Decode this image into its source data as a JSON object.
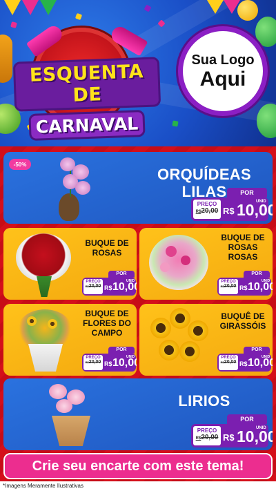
{
  "header": {
    "title_line1": "ESQUENTA DE",
    "title_line2": "CARNAVAL",
    "logo_line1": "Sua Logo",
    "logo_line2": "Aqui"
  },
  "products": [
    {
      "name": "ORQUÍDEAS LILAS",
      "discount": "-50%",
      "por": "POR",
      "preco_label": "PREÇO",
      "old_prefix": "R$",
      "old_price": "20,00",
      "currency": "R$",
      "price": "10,00",
      "unit": "UNID"
    },
    {
      "name": "BUQUE DE ROSAS",
      "por": "POR",
      "preco_label": "PREÇO",
      "old_prefix": "R$",
      "old_price": "20,00",
      "currency": "R$",
      "price": "10,00",
      "unit": "UNID"
    },
    {
      "name": "BUQUE DE ROSAS ROSAS",
      "por": "POR",
      "preco_label": "PREÇO",
      "old_prefix": "R$",
      "old_price": "20,00",
      "currency": "R$",
      "price": "10,00",
      "unit": "UNID"
    },
    {
      "name": "BUQUE DE FLORES DO CAMPO",
      "por": "POR",
      "preco_label": "PREÇO",
      "old_prefix": "R$",
      "old_price": "20,00",
      "currency": "R$",
      "price": "10,00",
      "unit": "UNID"
    },
    {
      "name": "BUQUÊ DE GIRASSÓIS",
      "por": "POR",
      "preco_label": "PREÇO",
      "old_prefix": "R$",
      "old_price": "20,00",
      "currency": "R$",
      "price": "10,00",
      "unit": "UNID"
    },
    {
      "name": "LIRIOS",
      "por": "POR",
      "preco_label": "PREÇO",
      "old_prefix": "R$",
      "old_price": "20,00",
      "currency": "R$",
      "price": "10,00",
      "unit": "UNID"
    }
  ],
  "cta": "Crie seu encarte com este tema!",
  "disclaimer": "*Imagens Meramente Ilustrativas",
  "colors": {
    "accent_purple": "#7b1fb0",
    "accent_pink": "#ec2d8f",
    "card_blue": "#2a72df",
    "card_yellow": "#ffc21a",
    "background_red": "#d40f1a"
  }
}
